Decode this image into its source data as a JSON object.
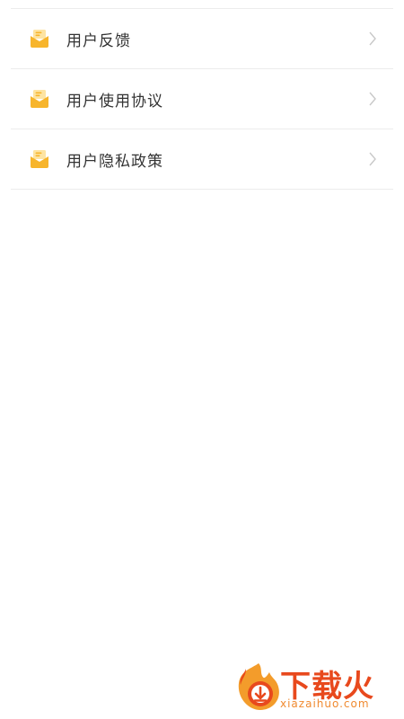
{
  "menu": {
    "items": [
      {
        "label": "用户反馈",
        "icon": "mail-icon"
      },
      {
        "label": "用户使用协议",
        "icon": "mail-icon"
      },
      {
        "label": "用户隐私政策",
        "icon": "mail-icon"
      }
    ]
  },
  "watermark": {
    "title": "下载火",
    "url": "xiazaihuo.com"
  },
  "colors": {
    "icon_primary": "#f7b52c",
    "icon_light": "#fde4a3",
    "divider": "#ececec",
    "label": "#333333",
    "chevron": "#c8c8c8",
    "watermark": "#e8491d"
  }
}
